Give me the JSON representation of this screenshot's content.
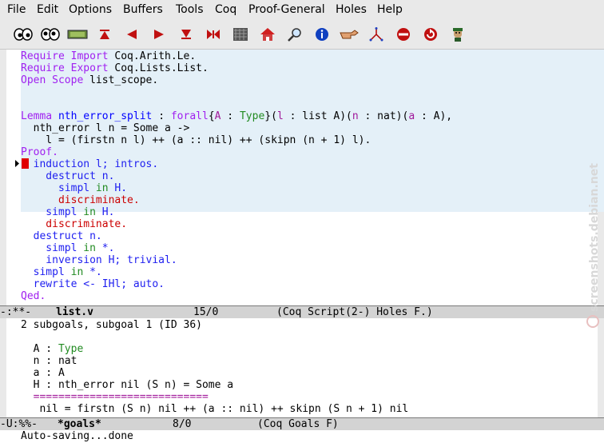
{
  "menu": [
    "File",
    "Edit",
    "Options",
    "Buffers",
    "Tools",
    "Coq",
    "Proof-General",
    "Holes",
    "Help"
  ],
  "toolbar": {
    "buttons": [
      {
        "icon": "goals-eyes-icon"
      },
      {
        "icon": "retract-eyes-icon"
      },
      {
        "icon": "state-display-icon"
      },
      {
        "icon": "goto-start-icon"
      },
      {
        "icon": "undo-step-icon"
      },
      {
        "icon": "next-step-icon"
      },
      {
        "icon": "goto-end-icon"
      },
      {
        "icon": "goto-point-icon"
      },
      {
        "icon": "restart-icon"
      },
      {
        "icon": "home-icon"
      },
      {
        "icon": "find-icon"
      },
      {
        "icon": "info-icon"
      },
      {
        "icon": "command-icon"
      },
      {
        "icon": "prooftree-icon"
      },
      {
        "icon": "interrupt-icon"
      },
      {
        "icon": "refresh-icon"
      },
      {
        "icon": "help-icon"
      }
    ]
  },
  "script": {
    "lines": [
      [
        {
          "t": "Require Import",
          "c": "kw"
        },
        {
          "t": " Coq.Arith.Le."
        }
      ],
      [
        {
          "t": "Require Export",
          "c": "kw"
        },
        {
          "t": " Coq.Lists.List."
        }
      ],
      [
        {
          "t": "Open Scope",
          "c": "kw"
        },
        {
          "t": " list_scope."
        }
      ],
      [
        {
          "t": ""
        }
      ],
      [
        {
          "t": ""
        }
      ],
      [
        {
          "t": "Lemma",
          "c": "kw"
        },
        {
          "t": " "
        },
        {
          "t": "nth_error_split",
          "c": "fn"
        },
        {
          "t": " : "
        },
        {
          "t": "forall",
          "c": "kw"
        },
        {
          "t": "{"
        },
        {
          "t": "A",
          "c": "pu"
        },
        {
          "t": " : "
        },
        {
          "t": "Type",
          "c": "gr"
        },
        {
          "t": "}("
        },
        {
          "t": "l",
          "c": "pu"
        },
        {
          "t": " : list A)("
        },
        {
          "t": "n",
          "c": "pu"
        },
        {
          "t": " : nat)("
        },
        {
          "t": "a",
          "c": "pu"
        },
        {
          "t": " : A),"
        }
      ],
      [
        {
          "t": "  nth_error l n = Some a ->"
        }
      ],
      [
        {
          "t": "    l = (firstn n l) ++ (a :: nil) ++ (skipn (n + 1) l)."
        }
      ],
      [
        {
          "t": "Proof.",
          "c": "kw"
        }
      ],
      [
        {
          "t": "  induction l; intros.",
          "c": "bl"
        }
      ],
      [
        {
          "t": "    destruct n.",
          "c": "bl"
        }
      ],
      [
        {
          "t": "      simpl ",
          "c": "bl"
        },
        {
          "t": "in",
          "c": "gr"
        },
        {
          "t": " H.",
          "c": "bl"
        }
      ],
      [
        {
          "t": "      discriminate.",
          "c": "red"
        }
      ],
      [
        {
          "t": "    simpl ",
          "c": "bl"
        },
        {
          "t": "in",
          "c": "gr"
        },
        {
          "t": " H.",
          "c": "bl"
        }
      ],
      [
        {
          "t": "    discriminate.",
          "c": "red"
        }
      ],
      [
        {
          "t": "  destruct n.",
          "c": "bl"
        }
      ],
      [
        {
          "t": "    simpl ",
          "c": "bl"
        },
        {
          "t": "in",
          "c": "gr"
        },
        {
          "t": " *.",
          "c": "bl"
        }
      ],
      [
        {
          "t": "    inversion H; trivial.",
          "c": "bl"
        }
      ],
      [
        {
          "t": "  simpl ",
          "c": "bl"
        },
        {
          "t": "in",
          "c": "gr"
        },
        {
          "t": " *.",
          "c": "bl"
        }
      ],
      [
        {
          "t": "  rewrite <- IHl; auto.",
          "c": "bl"
        }
      ],
      [
        {
          "t": "Qed.",
          "c": "kw"
        }
      ]
    ]
  },
  "modeline1": {
    "flags": "-:**-  ",
    "buffer": "list.v",
    "position": "15/0",
    "mode": "(Coq Script(2-) Holes F.)"
  },
  "goals": {
    "lines": [
      [
        {
          "t": "2 subgoals, subgoal 1 (ID 36)"
        }
      ],
      [
        {
          "t": ""
        }
      ],
      [
        {
          "t": "  A : "
        },
        {
          "t": "Type",
          "c": "gr"
        }
      ],
      [
        {
          "t": "  n : nat"
        }
      ],
      [
        {
          "t": "  a : A"
        }
      ],
      [
        {
          "t": "  H : nth_error nil (S n) = Some a"
        }
      ],
      [
        {
          "t": "  ============================",
          "c": "pu"
        }
      ],
      [
        {
          "t": "   nil = firstn (S n) nil ++ (a :: nil) ++ skipn (S n + 1) nil"
        }
      ]
    ]
  },
  "modeline2": {
    "flags": "-U:%%-  ",
    "buffer": "*goals*",
    "position": "8/0",
    "mode": "(Coq Goals F)"
  },
  "minibuffer": "Auto-saving...done",
  "watermark": "screenshots.debian.net",
  "colors": {
    "locked_region": "#e4f0f8",
    "keyword": "#a020f0",
    "tactic": "#1e1ef0",
    "error": "#cc0000"
  }
}
